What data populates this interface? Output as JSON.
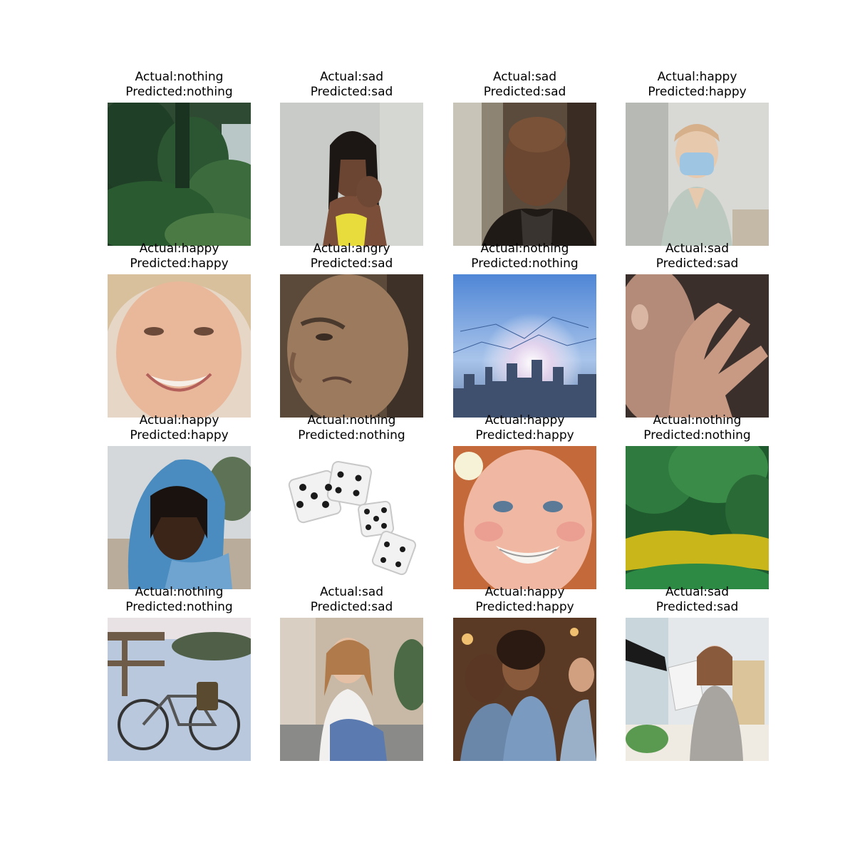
{
  "grid": {
    "cells": [
      {
        "actual": "Actual:nothing",
        "predicted": "Predicted:nothing",
        "scene": "forest-cliff"
      },
      {
        "actual": "Actual:sad",
        "predicted": "Predicted:sad",
        "scene": "braided-woman"
      },
      {
        "actual": "Actual:sad",
        "predicted": "Predicted:sad",
        "scene": "older-man"
      },
      {
        "actual": "Actual:happy",
        "predicted": "Predicted:happy",
        "scene": "woman-face-mask"
      },
      {
        "actual": "Actual:happy",
        "predicted": "Predicted:happy",
        "scene": "smiling-woman"
      },
      {
        "actual": "Actual:angry",
        "predicted": "Predicted:sad",
        "scene": "frowning-man"
      },
      {
        "actual": "Actual:nothing",
        "predicted": "Predicted:nothing",
        "scene": "city-network"
      },
      {
        "actual": "Actual:sad",
        "predicted": "Predicted:sad",
        "scene": "hand-on-neck"
      },
      {
        "actual": "Actual:happy",
        "predicted": "Predicted:happy",
        "scene": "woman-blue-scarf"
      },
      {
        "actual": "Actual:nothing",
        "predicted": "Predicted:nothing",
        "scene": "dice"
      },
      {
        "actual": "Actual:happy",
        "predicted": "Predicted:happy",
        "scene": "girl-braces"
      },
      {
        "actual": "Actual:nothing",
        "predicted": "Predicted:nothing",
        "scene": "swamp-pond"
      },
      {
        "actual": "Actual:nothing",
        "predicted": "Predicted:nothing",
        "scene": "bicycle-snow"
      },
      {
        "actual": "Actual:sad",
        "predicted": "Predicted:sad",
        "scene": "woman-on-sofa"
      },
      {
        "actual": "Actual:happy",
        "predicted": "Predicted:happy",
        "scene": "friends-bar"
      },
      {
        "actual": "Actual:sad",
        "predicted": "Predicted:sad",
        "scene": "office-woman"
      }
    ]
  }
}
